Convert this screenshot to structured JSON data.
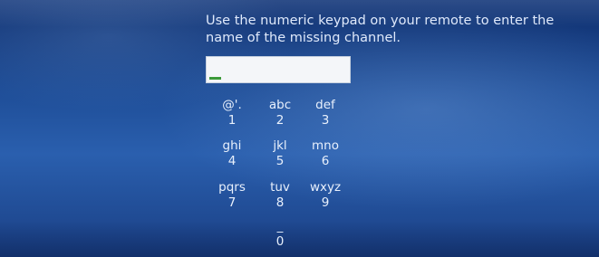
{
  "prompt": {
    "text": "Use the numeric keypad on your remote to enter the name of the missing channel."
  },
  "entry": {
    "value": ""
  },
  "keypad": {
    "keys": [
      {
        "letters": "@'.",
        "digit": "1"
      },
      {
        "letters": "abc",
        "digit": "2"
      },
      {
        "letters": "def",
        "digit": "3"
      },
      {
        "letters": "ghi",
        "digit": "4"
      },
      {
        "letters": "jkl",
        "digit": "5"
      },
      {
        "letters": "mno",
        "digit": "6"
      },
      {
        "letters": "pqrs",
        "digit": "7"
      },
      {
        "letters": "tuv",
        "digit": "8"
      },
      {
        "letters": "wxyz",
        "digit": "9"
      },
      {
        "letters": "_",
        "digit": "0"
      }
    ]
  },
  "colors": {
    "background": "#1e4d97",
    "text": "#dfe9fb",
    "caret": "#3c9a3a",
    "entry_bg": "#f4f6f9"
  }
}
